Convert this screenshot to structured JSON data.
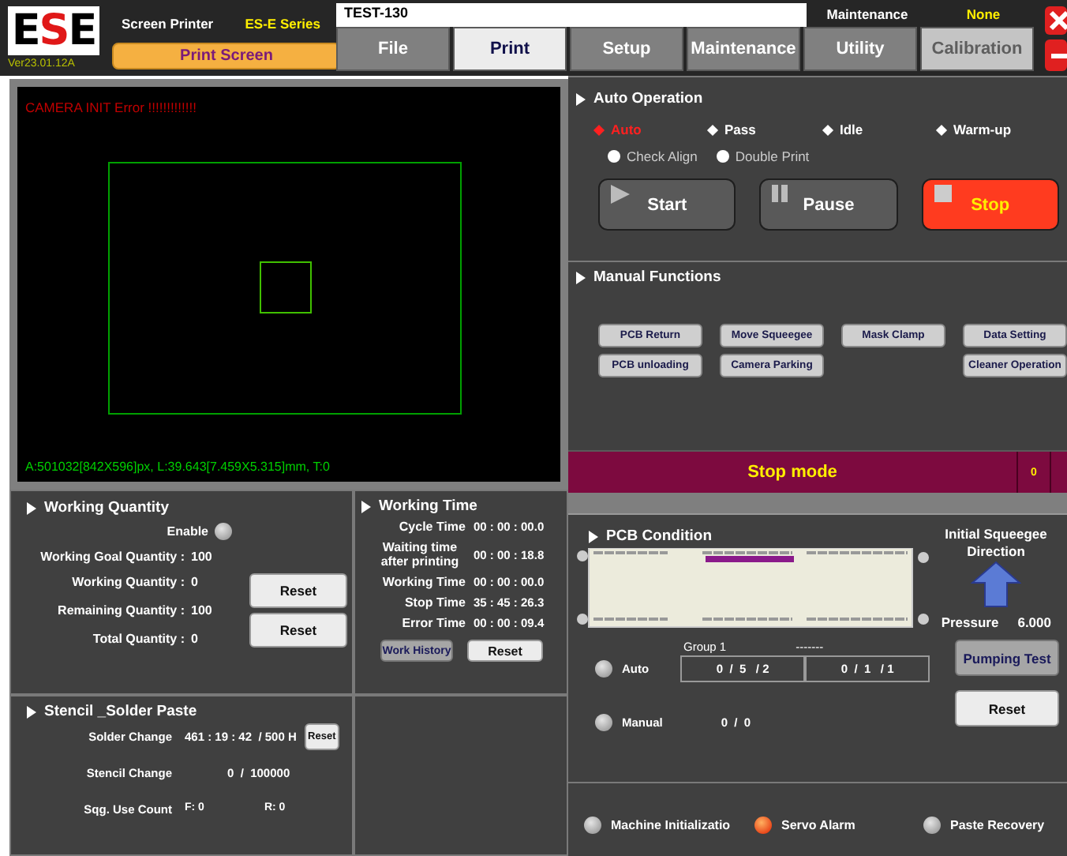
{
  "header": {
    "logo": "ESE",
    "version": "Ver23.01.12A",
    "product": "Screen Printer",
    "series": "ES-E Series",
    "screen_button": "Print Screen",
    "title": "TEST-130",
    "mode": "Maintenance",
    "status": "None"
  },
  "tabs": [
    {
      "label": "File",
      "selected": false,
      "disabled": false
    },
    {
      "label": "Print",
      "selected": true,
      "disabled": false
    },
    {
      "label": "Setup",
      "selected": false,
      "disabled": false
    },
    {
      "label": "Maintenance",
      "selected": false,
      "disabled": false
    },
    {
      "label": "Utility",
      "selected": false,
      "disabled": false
    },
    {
      "label": "Calibration",
      "selected": false,
      "disabled": true
    }
  ],
  "camera": {
    "error": "CAMERA INIT Error !!!!!!!!!!!!!",
    "info": "A:501032[842X596]px, L:39.643[7.459X5.315]mm, T:0"
  },
  "working_quantity": {
    "title": "Working Quantity",
    "enable_label": "Enable",
    "enabled": false,
    "rows": [
      {
        "label": "Working Goal Quantity :",
        "value": "100"
      },
      {
        "label": "Working Quantity :",
        "value": "0"
      },
      {
        "label": "Remaining Quantity :",
        "value": "100"
      },
      {
        "label": "Total Quantity :",
        "value": "0"
      }
    ],
    "buttons": [
      "Reset",
      "Reset"
    ]
  },
  "working_time": {
    "title": "Working Time",
    "rows": [
      {
        "label": "Cycle Time",
        "value": "00 : 00 : 00.0"
      },
      {
        "label": "Waiting time after printing",
        "value": "00 : 00 : 18.8"
      },
      {
        "label": "Working Time",
        "value": "00 : 00 : 00.0"
      },
      {
        "label": "Stop Time",
        "value": "35 : 45 : 26.3"
      },
      {
        "label": "Error Time",
        "value": "00 : 00 : 09.4"
      }
    ],
    "buttons": [
      {
        "label": "Work History",
        "kind": "grey"
      },
      {
        "label": "Reset",
        "kind": "light"
      }
    ]
  },
  "stencil": {
    "title": "Stencil _Solder Paste",
    "solder_label": "Solder Change",
    "solder_value": "461 : 19 : 42  / 500 H",
    "solder_button": "Reset",
    "stencil_label": "Stencil Change",
    "stencil_value": "0  /  100000",
    "count_label": "Sqg. Use Count",
    "count_front": "F: 0",
    "count_rear": "R: 0"
  },
  "auto_operation": {
    "title": "Auto Operation",
    "modes": [
      {
        "label": "Auto",
        "selected": true
      },
      {
        "label": "Pass",
        "selected": false
      },
      {
        "label": "Idle",
        "selected": false
      },
      {
        "label": "Warm-up",
        "selected": false
      }
    ],
    "options": [
      {
        "label": "Check Align",
        "checked": false
      },
      {
        "label": "Double Print",
        "checked": false
      }
    ],
    "buttons": [
      {
        "label": "Start",
        "kind": "start",
        "selected": false
      },
      {
        "label": "Pause",
        "kind": "pause",
        "selected": false
      },
      {
        "label": "Stop",
        "kind": "stop",
        "selected": true
      }
    ]
  },
  "manual_functions": {
    "title": "Manual Functions",
    "columns": [
      [
        "PCB Return",
        "PCB unloading"
      ],
      [
        "Move Squeegee",
        "Camera Parking"
      ],
      [
        "Mask Clamp"
      ],
      [
        "Data Setting",
        "Cleaner Operation"
      ]
    ]
  },
  "status": {
    "mode": "Stop mode",
    "count": "0"
  },
  "pcb_condition": {
    "title": "PCB Condition",
    "squeegee_title": "Initial Squeegee Direction",
    "pressure_label": "Pressure",
    "pressure": "6.000"
  },
  "cleaning": {
    "groups": [
      "Group 1",
      "-------"
    ],
    "modes": [
      {
        "label": "Auto",
        "on": false,
        "values": [
          "0  /  5   / 2",
          "0  /  1   / 1"
        ]
      },
      {
        "label": "Manual",
        "on": false,
        "values": [
          "0  /  0"
        ]
      }
    ],
    "buttons": [
      {
        "label": "Pumping Test",
        "kind": "grey"
      },
      {
        "label": "Reset",
        "kind": "light"
      }
    ]
  },
  "indicators": [
    {
      "label": "Machine Initializatio",
      "on": false
    },
    {
      "label": "Servo Alarm",
      "on": true
    },
    {
      "label": "Paste Recovery",
      "on": false
    }
  ]
}
